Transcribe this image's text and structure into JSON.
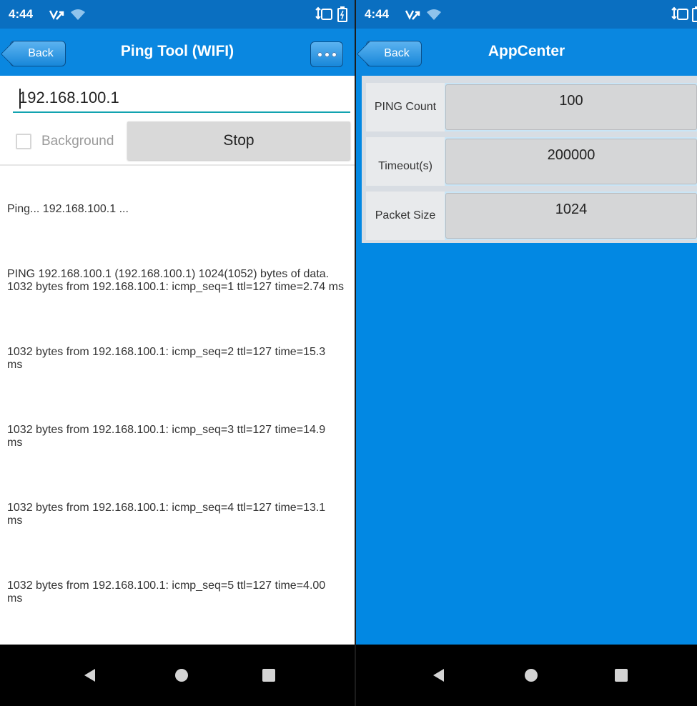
{
  "left_screen": {
    "status_bar": {
      "time": "4:44",
      "icons": [
        "usb-debug-icon",
        "wifi-icon",
        "nfc-icon",
        "battery-icon"
      ]
    },
    "app_bar": {
      "back_label": "Back",
      "title": "Ping Tool (WIFI)",
      "menu_icon": "more-dots-icon"
    },
    "ip_input": {
      "value": "192.168.100.1",
      "placeholder": ""
    },
    "background_checkbox": {
      "label": "Background",
      "checked": false
    },
    "stop_button": {
      "label": "Stop"
    },
    "log": [
      "Ping... 192.168.100.1 ...",
      "PING 192.168.100.1 (192.168.100.1) 1024(1052) bytes of data.\n1032 bytes from 192.168.100.1: icmp_seq=1 ttl=127 time=2.74 ms",
      "1032 bytes from 192.168.100.1: icmp_seq=2 ttl=127 time=15.3 ms",
      "1032 bytes from 192.168.100.1: icmp_seq=3 ttl=127 time=14.9 ms",
      "1032 bytes from 192.168.100.1: icmp_seq=4 ttl=127 time=13.1 ms",
      "1032 bytes from 192.168.100.1: icmp_seq=5 ttl=127 time=4.00 ms"
    ]
  },
  "right_screen": {
    "status_bar": {
      "time": "4:44",
      "icons": [
        "usb-debug-icon",
        "wifi-icon",
        "nfc-icon",
        "battery-icon"
      ]
    },
    "app_bar": {
      "back_label": "Back",
      "title": "AppCenter"
    },
    "fields": [
      {
        "label": "PING Count",
        "value": "100"
      },
      {
        "label": "Timeout(s)",
        "value": "200000"
      },
      {
        "label": "Packet Size",
        "value": "1024"
      }
    ]
  },
  "nav_bar": {
    "icons": [
      "back-triangle-icon",
      "home-circle-icon",
      "recents-square-icon"
    ]
  },
  "colors": {
    "status_bar": "#0a6fc1",
    "app_bar": "#0a87e0",
    "right_background": "#0288e3",
    "input_underline": "#12a3b0",
    "nav_bar": "#000000"
  }
}
